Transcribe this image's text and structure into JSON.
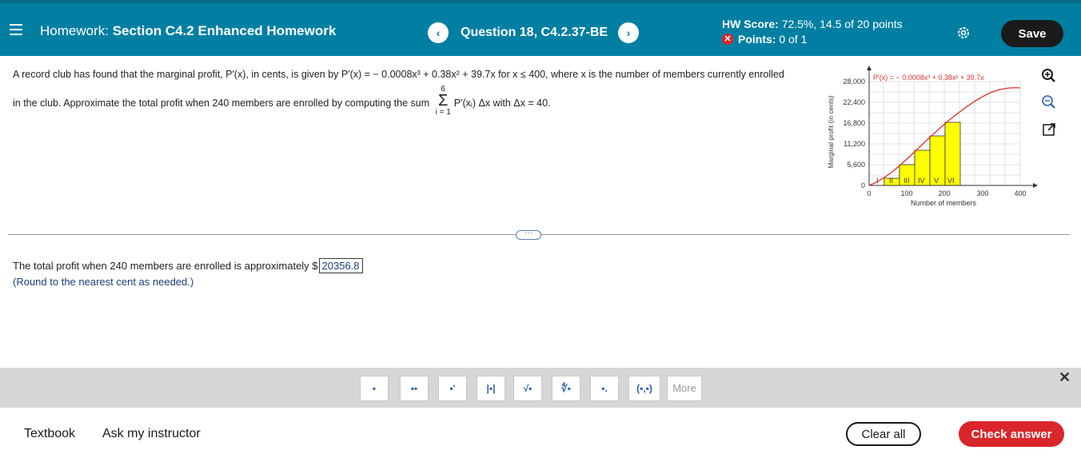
{
  "header": {
    "title_prefix": "Homework: ",
    "title_main": "Section C4.2 Enhanced Homework",
    "question": "Question 18, C4.2.37-BE",
    "prev": "‹",
    "next": "›",
    "hw_score_label": "HW Score:",
    "hw_score_value": "72.5%, 14.5 of 20 points",
    "points_label": "Points:",
    "points_value": "0 of 1",
    "save": "Save"
  },
  "question": {
    "line1": "A record club has found that the marginal profit, P′(x), in cents, is given by P′(x) = − 0.0008x³ + 0.38x² + 39.7x for x ≤ 400, where x is the number of members currently enrolled",
    "line2_a": "in the club. Approximate the total profit when 240 members are enrolled by computing the sum",
    "sum_top": "6",
    "sum_sigma": "Σ",
    "sum_bottom": "i = 1",
    "sum_body": "P′(xᵢ) Δx with Δx = 40."
  },
  "graph": {
    "legend": "P′(x) = − 0.0008x³ + 0.38x² + 39.7x",
    "ylabel": "Marginal profit (in cents)",
    "xlabel": "Number of members",
    "yticks": [
      "0",
      "5,600",
      "11,200",
      "16,800",
      "22,400",
      "28,000"
    ],
    "xticks": [
      "0",
      "100",
      "200",
      "300",
      "400"
    ],
    "rect_labels": [
      "I",
      "II",
      "III",
      "IV",
      "V",
      "VI"
    ]
  },
  "answer": {
    "prefix": "The total profit when 240 members are enrolled is approximately $",
    "value": "20356.8",
    "hint": "(Round to the nearest cent as needed.)"
  },
  "toolbar": {
    "tools": [
      "fraction-icon",
      "mixed-number-icon",
      "exponent-icon",
      "absolute-value-icon",
      "sqrt-icon",
      "nth-root-icon",
      "decimal-icon",
      "ordered-pair-icon"
    ],
    "more": "More",
    "close": "✕"
  },
  "footer": {
    "textbook": "Textbook",
    "ask": "Ask my instructor",
    "clear": "Clear all",
    "check": "Check answer"
  },
  "colors": {
    "header_bg": "#007fa3",
    "check_button": "#d9262b",
    "save_button": "#1a1a1a",
    "bar_fill": "#ffff00",
    "curve": "#e03030"
  }
}
